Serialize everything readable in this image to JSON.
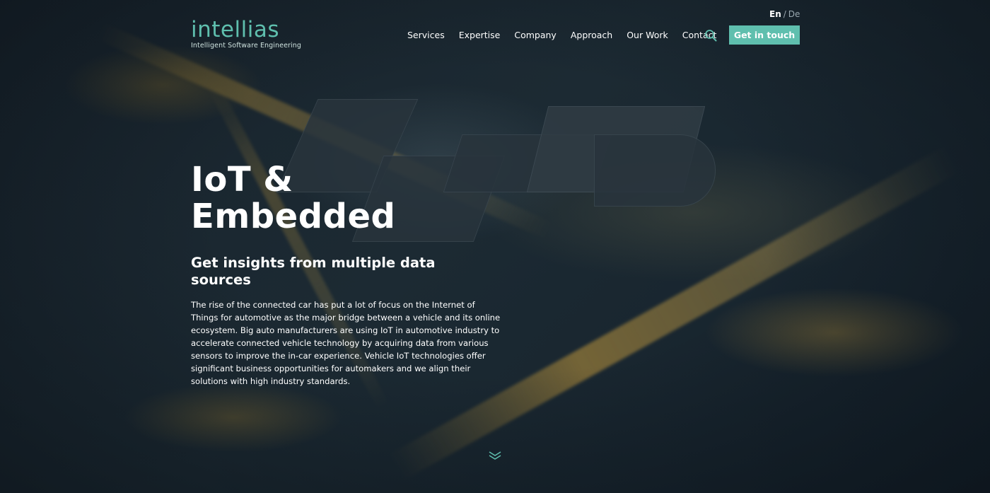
{
  "header": {
    "logo": {
      "name": "intellias",
      "tagline": "Intelligent Software Engineering"
    },
    "lang": {
      "active": "En",
      "separator": "/",
      "other": "De"
    },
    "nav": [
      "Services",
      "Expertise",
      "Company",
      "Approach",
      "Our Work",
      "Contact"
    ],
    "search_icon": "search-icon",
    "cta_label": "Get in touch"
  },
  "hero": {
    "title_line1": "IoT &",
    "title_line2": "Embedded",
    "subtitle": "Get insights from multiple data sources",
    "body": "The rise of the connected car has put a lot of focus on the Internet of Things for automotive as the major bridge between a vehicle and its online ecosystem. Big auto manufacturers are using IoT in automotive industry to accelerate connected vehicle technology by acquiring data from various sensors to improve the in-car experience. Vehicle IoT technologies offer significant business opportunities for automakers and we align their solutions with high industry standards.",
    "scroll_icon": "chevron-down-icon"
  },
  "colors": {
    "accent": "#5fbfae",
    "text": "#ffffff",
    "background": "#16212a"
  }
}
